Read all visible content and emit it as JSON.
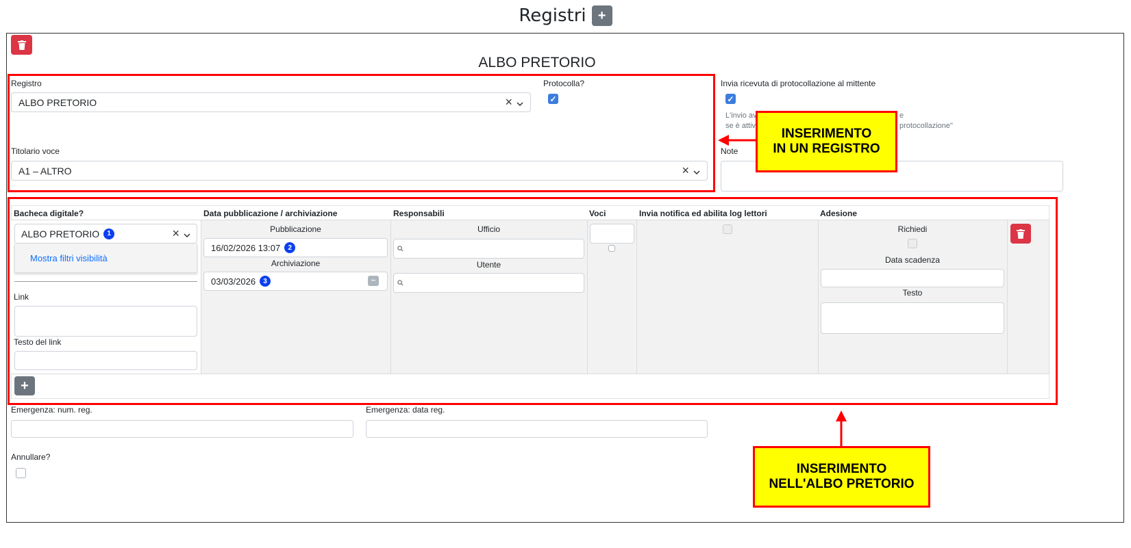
{
  "header": {
    "title": "Registri",
    "add_label": "+"
  },
  "panel": {
    "section_title": "ALBO PRETORIO",
    "registro": {
      "label": "Registro",
      "value": "ALBO PRETORIO"
    },
    "protocolla": {
      "label": "Protocolla?",
      "checked": true
    },
    "invia_ricevuta": {
      "label": "Invia ricevuta di protocollazione al mittente",
      "checked": true,
      "help_line1_start": "L'invio av",
      "help_line1_end": "e",
      "help_line2_start": "se è attiva",
      "help_line2_end": "protocollazione\""
    },
    "titolario": {
      "label": "Titolario voce",
      "value": "A1 – ALTRO"
    },
    "note": {
      "label": "Note",
      "value": ""
    }
  },
  "bacheca": {
    "headers": {
      "bacheca": "Bacheca digitale?",
      "data": "Data pubblicazione / archiviazione",
      "responsabili": "Responsabili",
      "voci": "Voci",
      "invia": "Invia notifica ed abilita log lettori",
      "adesione": "Adesione"
    },
    "select_value": "ALBO PRETORIO",
    "badge1": "1",
    "filtri_link": "Mostra filtri visibilità",
    "link_label": "Link",
    "testo_link_label": "Testo del link",
    "pubblicazione_label": "Pubblicazione",
    "pubblicazione_value": "16/02/2026 13:07",
    "badge2": "2",
    "archiviazione_label": "Archiviazione",
    "archiviazione_value": "03/03/2026",
    "badge3": "3",
    "ufficio_label": "Ufficio",
    "utente_label": "Utente",
    "richiedi_label": "Richiedi",
    "data_scadenza_label": "Data scadenza",
    "testo_label": "Testo",
    "add_row_label": "+"
  },
  "bottom": {
    "emergenza_num_label": "Emergenza: num. reg.",
    "emergenza_data_label": "Emergenza: data reg.",
    "annullare_label": "Annullare?"
  },
  "annotations": {
    "callout1_line1": "INSERIMENTO",
    "callout1_line2": "IN UN REGISTRO",
    "callout2_line1": "INSERIMENTO",
    "callout2_line2": "NELL'ALBO PRETORIO"
  },
  "icons": {
    "trash": "trash-icon",
    "clear": "×",
    "chevron": "⌄",
    "search": "search-icon",
    "check": "✓",
    "dots": "•••"
  },
  "colors": {
    "danger": "#dc3545",
    "secondary": "#6c757d",
    "checkbox": "#3b7ddd",
    "badge": "#0b3ff0",
    "annotation_border": "#ff0000",
    "annotation_fill": "#ffff00",
    "link": "#0d6efd"
  }
}
